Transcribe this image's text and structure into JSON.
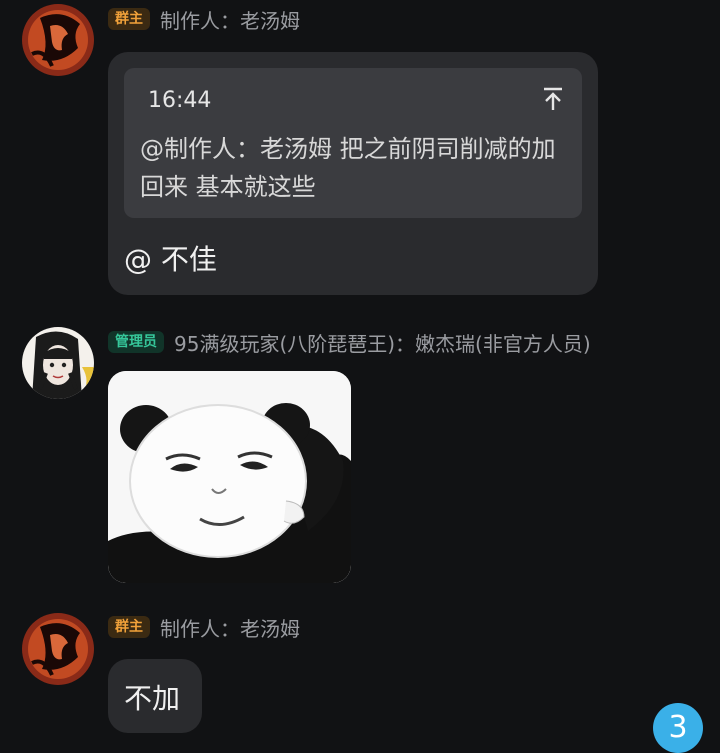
{
  "messages": [
    {
      "badge": "群主",
      "sender": "制作人：老汤姆",
      "quote": {
        "time": "16:44",
        "text": "@制作人：老汤姆 把之前阴司削减的加回来  基本就这些"
      },
      "reply": "@ 不佳"
    },
    {
      "badge": "管理员",
      "sender": "95满级玩家(八阶琵琶王)：嫩杰瑞(非官方人员)",
      "sticker": "panda-meme"
    },
    {
      "badge": "群主",
      "sender": "制作人：老汤姆",
      "text": "不加"
    }
  ],
  "unread_count": "3",
  "colors": {
    "background": "#111214",
    "bubble": "#2a2b2e",
    "quote": "#3b3c40",
    "owner_badge": "#f0a13a",
    "admin_badge": "#36c79a",
    "unread": "#3ab0e8"
  }
}
